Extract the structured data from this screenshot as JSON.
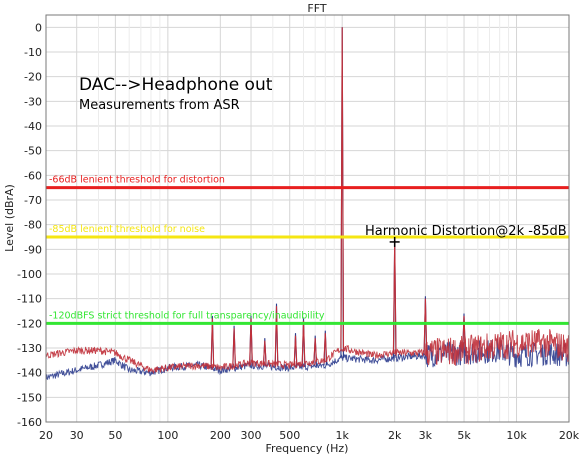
{
  "chart_data": {
    "type": "line",
    "title": "FFT",
    "xlabel": "Frequency (Hz)",
    "ylabel": "Level (dBrA)",
    "x_scale": "log",
    "xlim": [
      20,
      20000
    ],
    "ylim": [
      -160,
      5
    ],
    "x_ticks": [
      {
        "v": 20,
        "label": "20"
      },
      {
        "v": 30,
        "label": "30"
      },
      {
        "v": 50,
        "label": "50"
      },
      {
        "v": 100,
        "label": "100"
      },
      {
        "v": 200,
        "label": "200"
      },
      {
        "v": 300,
        "label": "300"
      },
      {
        "v": 500,
        "label": "500"
      },
      {
        "v": 1000,
        "label": "1k"
      },
      {
        "v": 2000,
        "label": "2k"
      },
      {
        "v": 3000,
        "label": "3k"
      },
      {
        "v": 5000,
        "label": "5k"
      },
      {
        "v": 10000,
        "label": "10k"
      },
      {
        "v": 20000,
        "label": "20k"
      }
    ],
    "x_minor": [
      40,
      60,
      70,
      80,
      90,
      400,
      600,
      700,
      800,
      900,
      4000,
      6000,
      7000,
      8000,
      9000
    ],
    "y_ticks": [
      0,
      -10,
      -20,
      -30,
      -40,
      -50,
      -60,
      -70,
      -80,
      -90,
      -100,
      -110,
      -120,
      -130,
      -140,
      -150,
      -160
    ],
    "grid": true,
    "series": [
      {
        "color": "#2f3e8f",
        "floor": [
          [
            20,
            -142
          ],
          [
            30,
            -139
          ],
          [
            40,
            -137
          ],
          [
            50,
            -135
          ],
          [
            60,
            -139
          ],
          [
            80,
            -140
          ],
          [
            100,
            -138
          ],
          [
            150,
            -137
          ],
          [
            200,
            -139
          ],
          [
            300,
            -137
          ],
          [
            500,
            -138
          ],
          [
            800,
            -137
          ],
          [
            1000,
            -134
          ],
          [
            1500,
            -135
          ],
          [
            2000,
            -134
          ],
          [
            3000,
            -133
          ],
          [
            5000,
            -132
          ],
          [
            8000,
            -131
          ],
          [
            10000,
            -133
          ],
          [
            15000,
            -132
          ],
          [
            20000,
            -133
          ]
        ],
        "peaks": [
          [
            180,
            -117
          ],
          [
            240,
            -121
          ],
          [
            300,
            -117
          ],
          [
            360,
            -126
          ],
          [
            420,
            -112
          ],
          [
            540,
            -124
          ],
          [
            600,
            -118
          ],
          [
            700,
            -125
          ],
          [
            800,
            -123
          ],
          [
            1000,
            0
          ],
          [
            2000,
            -86
          ],
          [
            3000,
            -109
          ],
          [
            5000,
            -116
          ]
        ]
      },
      {
        "color": "#c0303a",
        "floor": [
          [
            20,
            -133
          ],
          [
            30,
            -131
          ],
          [
            40,
            -131
          ],
          [
            50,
            -132
          ],
          [
            60,
            -135
          ],
          [
            80,
            -139
          ],
          [
            100,
            -138
          ],
          [
            150,
            -137
          ],
          [
            200,
            -138
          ],
          [
            300,
            -136
          ],
          [
            500,
            -137
          ],
          [
            800,
            -135
          ],
          [
            1000,
            -130
          ],
          [
            1500,
            -133
          ],
          [
            2000,
            -132
          ],
          [
            3000,
            -132
          ],
          [
            5000,
            -131
          ],
          [
            8000,
            -129
          ],
          [
            10000,
            -128
          ],
          [
            15000,
            -128
          ],
          [
            20000,
            -130
          ]
        ],
        "peaks": [
          [
            180,
            -118
          ],
          [
            240,
            -122
          ],
          [
            300,
            -118
          ],
          [
            360,
            -127
          ],
          [
            420,
            -113
          ],
          [
            540,
            -125
          ],
          [
            600,
            -119
          ],
          [
            700,
            -126
          ],
          [
            800,
            -124
          ],
          [
            1000,
            0
          ],
          [
            2000,
            -86
          ],
          [
            3000,
            -110
          ],
          [
            5000,
            -117
          ]
        ]
      }
    ],
    "reference_lines": [
      {
        "y": -65,
        "color": "#e81f1f",
        "label": "-66dB lenient threshold for distortion"
      },
      {
        "y": -85,
        "color": "#f5e612",
        "label": "-85dB lenient threshold for noise"
      },
      {
        "y": -120,
        "color": "#33e633",
        "label": "-120dBFS strict threshold for full transparency/inaudibility"
      }
    ],
    "annotations": [
      {
        "text": "DAC-->Headphone out"
      },
      {
        "text": "Measurements from ASR"
      },
      {
        "text": "Harmonic Distortion@2k -85dB"
      }
    ],
    "marker": {
      "x": 2000,
      "y": -87
    }
  }
}
